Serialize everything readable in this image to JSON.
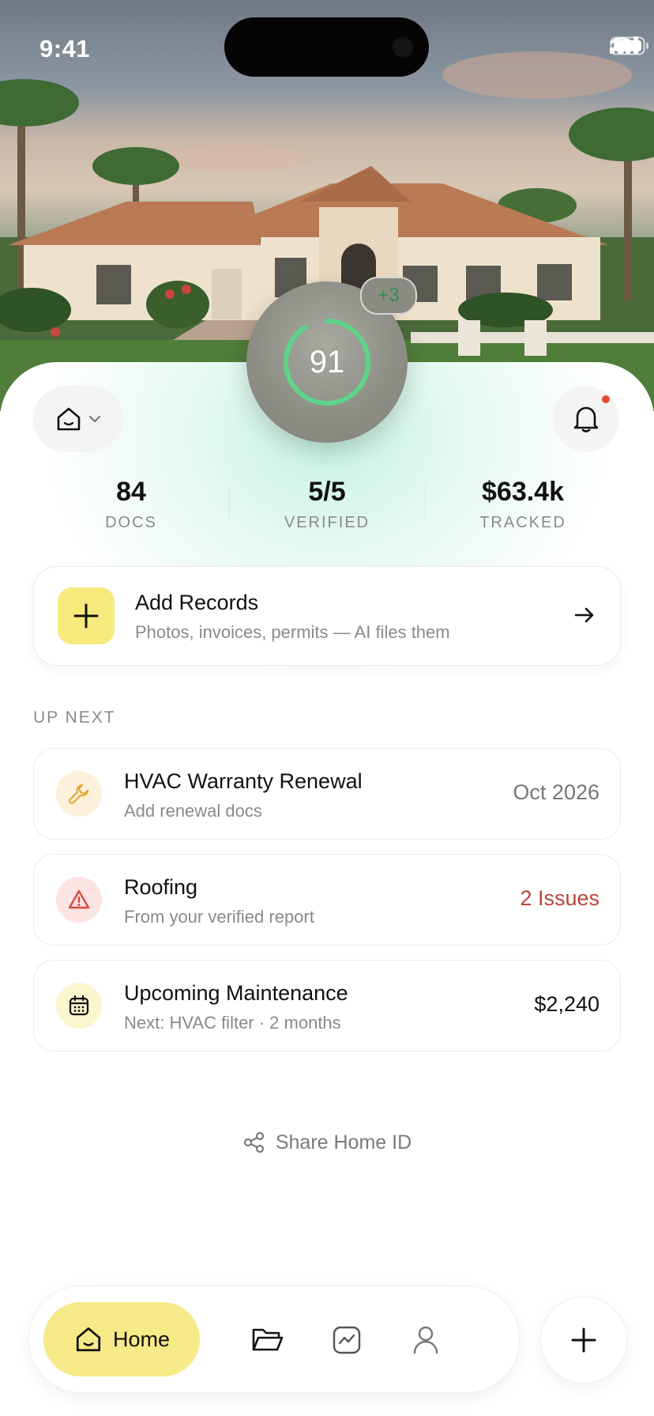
{
  "status_bar": {
    "time": "9:41"
  },
  "score": {
    "value": "91",
    "delta": "+3",
    "progress": 0.91
  },
  "stats": [
    {
      "value": "84",
      "label": "DOCS"
    },
    {
      "value": "5/5",
      "label": "VERIFIED"
    },
    {
      "value": "$63.4k",
      "label": "TRACKED"
    }
  ],
  "add_records": {
    "title": "Add Records",
    "subtitle": "Photos, invoices, permits — AI files them"
  },
  "up_next": {
    "label": "UP NEXT",
    "items": [
      {
        "title": "HVAC Warranty Renewal",
        "subtitle": "Add renewal docs",
        "meta": "Oct 2026",
        "icon": "wrench-icon",
        "meta_color": "#777777"
      },
      {
        "title": "Roofing",
        "subtitle": "From your verified report",
        "meta": "2 Issues",
        "icon": "warning-icon",
        "meta_color": "#b8443a"
      },
      {
        "title": "Upcoming Maintenance",
        "subtitle": "Next: HVAC filter · 2 months",
        "meta": "$2,240",
        "icon": "calendar-icon",
        "meta_color": "#111111"
      }
    ]
  },
  "share": {
    "label": "Share Home ID"
  },
  "nav": {
    "home_label": "Home"
  },
  "colors": {
    "accent_yellow": "#f7ea88",
    "score_green": "#5ed48a",
    "alert_red": "#e24b3b"
  }
}
